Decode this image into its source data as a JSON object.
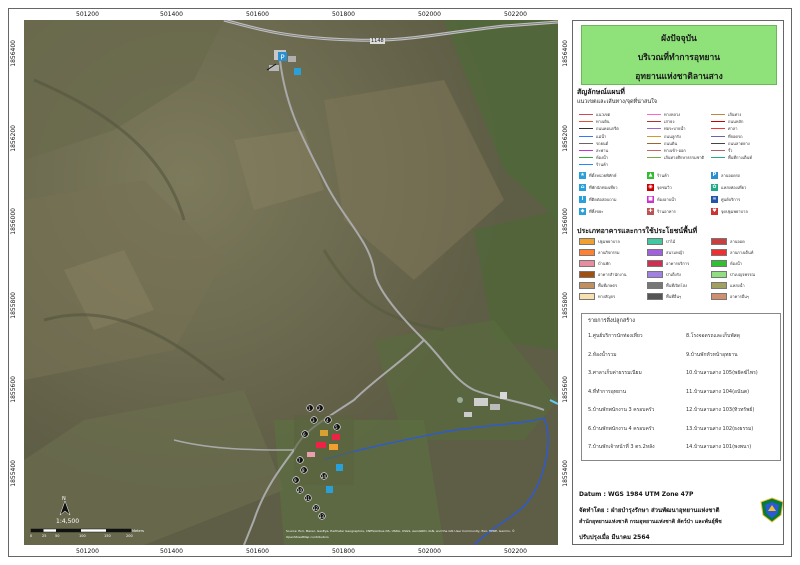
{
  "map": {
    "x_ticks": [
      "501200",
      "501400",
      "501600",
      "501800",
      "502000",
      "502200"
    ],
    "y_ticks": [
      "1856400",
      "1856200",
      "1856000",
      "1855800",
      "1855600",
      "1855400"
    ],
    "scale_text": "1:4,500",
    "scale_labels": [
      "0",
      "25",
      "50",
      "100",
      "150",
      "200"
    ],
    "scale_unit": "Meters",
    "credits": "Source: Esri, Maxar, GeoEye, Earthstar Geographics, CNES/Airbus DS, USDA, USGS, AeroGRID, IGN, and the GIS User Community, Esri, HERE, Garmin, ©",
    "credits2": "OpenStreetMap contributors",
    "road_label": "1148",
    "north_label": "N",
    "poi_numbers": [
      "1",
      "2",
      "3",
      "4",
      "5",
      "6",
      "7",
      "8",
      "9",
      "10",
      "11",
      "12",
      "13",
      "14"
    ]
  },
  "legend": {
    "title_1": "ผังปัจจุบัน",
    "title_2": "บริเวณที่ทำการอุทยาน",
    "title_3": "อุทยานแห่งชาติลานสาง",
    "symbols_header": "สัญลักษณ์แผนที่",
    "lines_subheader": "แนวเขตและเส้นทาง/จุดที่น่าสนใจ",
    "symbols": [
      {
        "label": "แนวเขต",
        "color": "#d4475a"
      },
      {
        "label": "ทางหลวง",
        "color": "#ff66cc"
      },
      {
        "label": "เส้นทาง",
        "color": "#bb8844"
      },
      {
        "label": "ทางเดิน",
        "color": "#d53"
      },
      {
        "label": "เสาธง",
        "color": "#a33"
      },
      {
        "label": "ถนนหลัก",
        "color": "#c00"
      },
      {
        "label": "ถนนคอนกรีต",
        "color": "#333"
      },
      {
        "label": "ท่อระบายน้ำ",
        "color": "#9966cc"
      },
      {
        "label": "ศาลา",
        "color": "#e33"
      },
      {
        "label": "แม่น้ำ",
        "color": "#3377ff"
      },
      {
        "label": "ถนนลูกรัง",
        "color": "#cc9933"
      },
      {
        "label": "ที่จอดรถ",
        "color": "#66a"
      },
      {
        "label": "รถยนต์",
        "color": "#666"
      },
      {
        "label": "ถนนดิน",
        "color": "#996633"
      },
      {
        "label": "ถนนลาดยาง",
        "color": "#444"
      },
      {
        "label": "สะพาน",
        "color": "#c3c"
      },
      {
        "label": "ทางเข้า-ออก",
        "color": "#c66"
      },
      {
        "label": "รั้ว",
        "color": "#a66"
      },
      {
        "label": "ห้องน้ำ",
        "color": "#3a3"
      },
      {
        "label": "เส้นทางศึกษาธรรมชาติ",
        "color": "#7a4"
      },
      {
        "label": "พื้นที่กางเต็นท์",
        "color": "#2a8"
      },
      {
        "label": "ร้านค้า",
        "color": "#28f"
      }
    ],
    "icon_rows": [
      {
        "label": "ที่ตั้งหน่วยพิทักษ์",
        "color": "#2aa0d8",
        "glyph": "★"
      },
      {
        "label": "ร้านค้า",
        "color": "#3b3",
        "glyph": "▲"
      },
      {
        "label": "ลานจอดรถ",
        "color": "#2a8fd0",
        "glyph": "P"
      },
      {
        "label": "ที่พักนักท่องเที่ยว",
        "color": "#2aa0d8",
        "glyph": "⌂"
      },
      {
        "label": "จุดชมวิว",
        "color": "#c00",
        "glyph": "◉"
      },
      {
        "label": "แหล่งท่องเที่ยว",
        "color": "#2a8",
        "glyph": "✿"
      },
      {
        "label": "ที่ติดต่อสอบถาม",
        "color": "#2aa0d8",
        "glyph": "i"
      },
      {
        "label": "ห้องอาบน้ำ",
        "color": "#c3c",
        "glyph": "■"
      },
      {
        "label": "ศูนย์บริการ",
        "color": "#2255aa",
        "glyph": "≈"
      },
      {
        "label": "ที่ทิ้งขยะ",
        "color": "#2aa0d8",
        "glyph": "◆"
      },
      {
        "label": "ร้านอาหาร",
        "color": "#b55",
        "glyph": "✚"
      },
      {
        "label": "จุดปฐมพยาบาล",
        "color": "#c33",
        "glyph": "♥"
      }
    ],
    "landuse_header": "ประเภทอาคารและการใช้ประโยชน์พื้นที่",
    "landuse": [
      {
        "label": "ปฐมพยาบาล",
        "color": "#f0a030"
      },
      {
        "label": "ป่าไม้",
        "color": "#40c8a0"
      },
      {
        "label": "ลานจอด",
        "color": "#c84040"
      },
      {
        "label": "ลานกิจกรรม",
        "color": "#ff8030"
      },
      {
        "label": "สนามหญ้า",
        "color": "#a060e0"
      },
      {
        "label": "ลานกางเต็นท์",
        "color": "#f03030"
      },
      {
        "label": "บ้านพัก",
        "color": "#e88ca0"
      },
      {
        "label": "อาคารบริการ",
        "color": "#d03050"
      },
      {
        "label": "ห้องน้ำ",
        "color": "#30c030"
      },
      {
        "label": "อาคารสำนักงาน",
        "color": "#a05010"
      },
      {
        "label": "ป่าเต็งรัง",
        "color": "#a080e0"
      },
      {
        "label": "ป่าเบญจพรรณ",
        "color": "#90e080"
      },
      {
        "label": "พื้นที่เกษตร",
        "color": "#c09060"
      },
      {
        "label": "พื้นที่เปิดโล่ง",
        "color": "#777777"
      },
      {
        "label": "แหล่งน้ำ",
        "color": "#a0a060"
      },
      {
        "label": "ทางสัญจร",
        "color": "#f8e0b0"
      },
      {
        "label": "พื้นที่อื่นๆ",
        "color": "#555555"
      },
      {
        "label": "อาคารอื่นๆ",
        "color": "#d09070"
      }
    ],
    "locations_header": "รายการสิ่งปลูกสร้าง",
    "locations_left": [
      "1.ศูนย์บริการนักท่องเที่ยว",
      "2.ห้องน้ำรวม",
      "3.ศาลาเก็บค่าธรรมเนียม",
      "4.ที่ทำการอุทยาน",
      "5.บ้านพักพนักงาน 3 ครอบครัว",
      "6.บ้านพักพนักงาน 4 ครอบครัว",
      "7.บ้านพักเจ้าหน้าที่ 3 ตร.2หลัง"
    ],
    "locations_right": [
      "8.โรงจอดรถและเก็บพัสดุ",
      "9.บ้านพักหัวหน้าอุทยาน",
      "10.บ้านลานสาง 105(พยัคฆ์ไพร)",
      "11.บ้านลานสาง 104(อนันต)",
      "12.บ้านลานสาง 103(ทิวทรัพย์)",
      "13.บ้านลานสาง 102(ธงธรรม)",
      "14.บ้านลานสาง 101(พงพนา)"
    ],
    "datum": "Datum  :  WGS 1984 UTM Zone 47P",
    "made_by": "จัดทำโดย  :  ฝ่ายบำรุงรักษา ส่วนพัฒนาอุทยานแห่งชาติ",
    "made_by_2": "สำนักอุทยานแห่งชาติ  กรมอุทยานแห่งชาติ สัตว์ป่า และพันธุ์พืช",
    "updated": "ปรับปรุงเมื่อ  มีนาคม 2564"
  }
}
